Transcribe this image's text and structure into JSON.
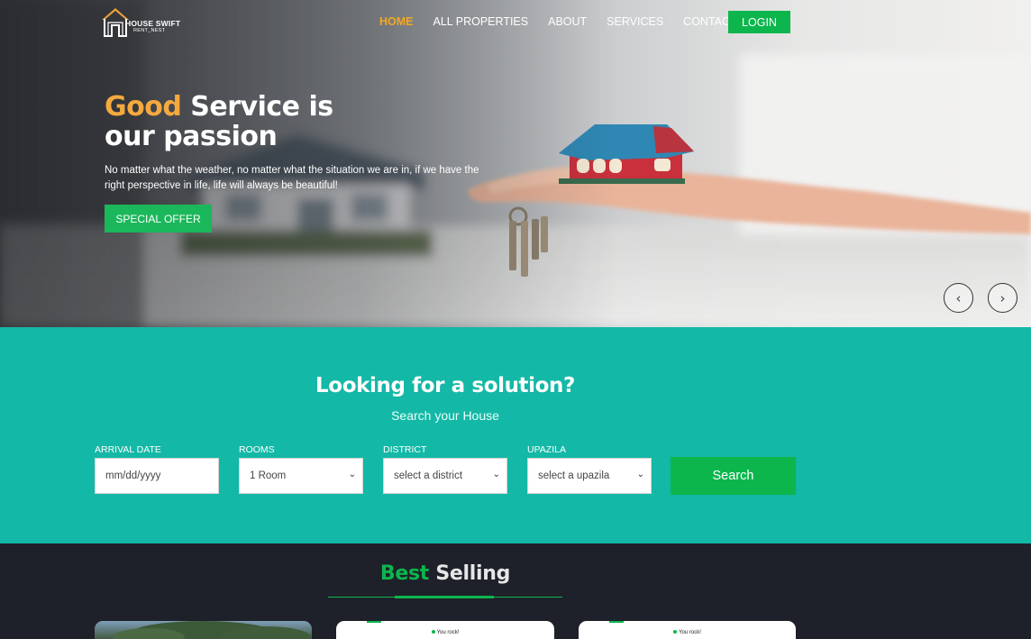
{
  "brand": {
    "name": "HOUSE SWIFT",
    "tagline": "RENT_NEST",
    "icon": "house-logo-icon"
  },
  "nav": {
    "items": [
      {
        "label": "HOME",
        "active": true
      },
      {
        "label": "ALL PROPERTIES",
        "active": false
      },
      {
        "label": "ABOUT",
        "active": false
      },
      {
        "label": "SERVICES",
        "active": false
      },
      {
        "label": "CONTACT",
        "active": false
      }
    ],
    "login_label": "LOGIN"
  },
  "hero": {
    "title_accent": "Good",
    "title_rest_line1": "Service is",
    "title_line2": "our passion",
    "text": "No matter what the weather, no matter what the situation we are in, if we have the right perspective in life, life will always be beautiful!",
    "offer_label": "SPECIAL OFFER",
    "prev_icon": "chevron-left-icon",
    "prev_glyph": "‹",
    "next_icon": "chevron-right-icon",
    "next_glyph": "›"
  },
  "search": {
    "title": "Looking for a solution?",
    "subtitle": "Search your House",
    "fields": {
      "arrival": {
        "label": "ARRIVAL DATE",
        "placeholder": "mm/dd/yyyy"
      },
      "rooms": {
        "label": "ROOMS",
        "value": "1 Room"
      },
      "district": {
        "label": "DISTRICT",
        "value": "select a district"
      },
      "upazila": {
        "label": "UPAZILA",
        "value": "select a upazila"
      }
    },
    "button_label": "Search"
  },
  "best_selling": {
    "title_word1": "Best",
    "title_word2": "Selling",
    "card_badge": "You rock!"
  },
  "colors": {
    "accent_orange": "#f5a623",
    "brand_green": "#0cb64d",
    "teal": "#14b8a6",
    "dark": "#1e2129"
  }
}
